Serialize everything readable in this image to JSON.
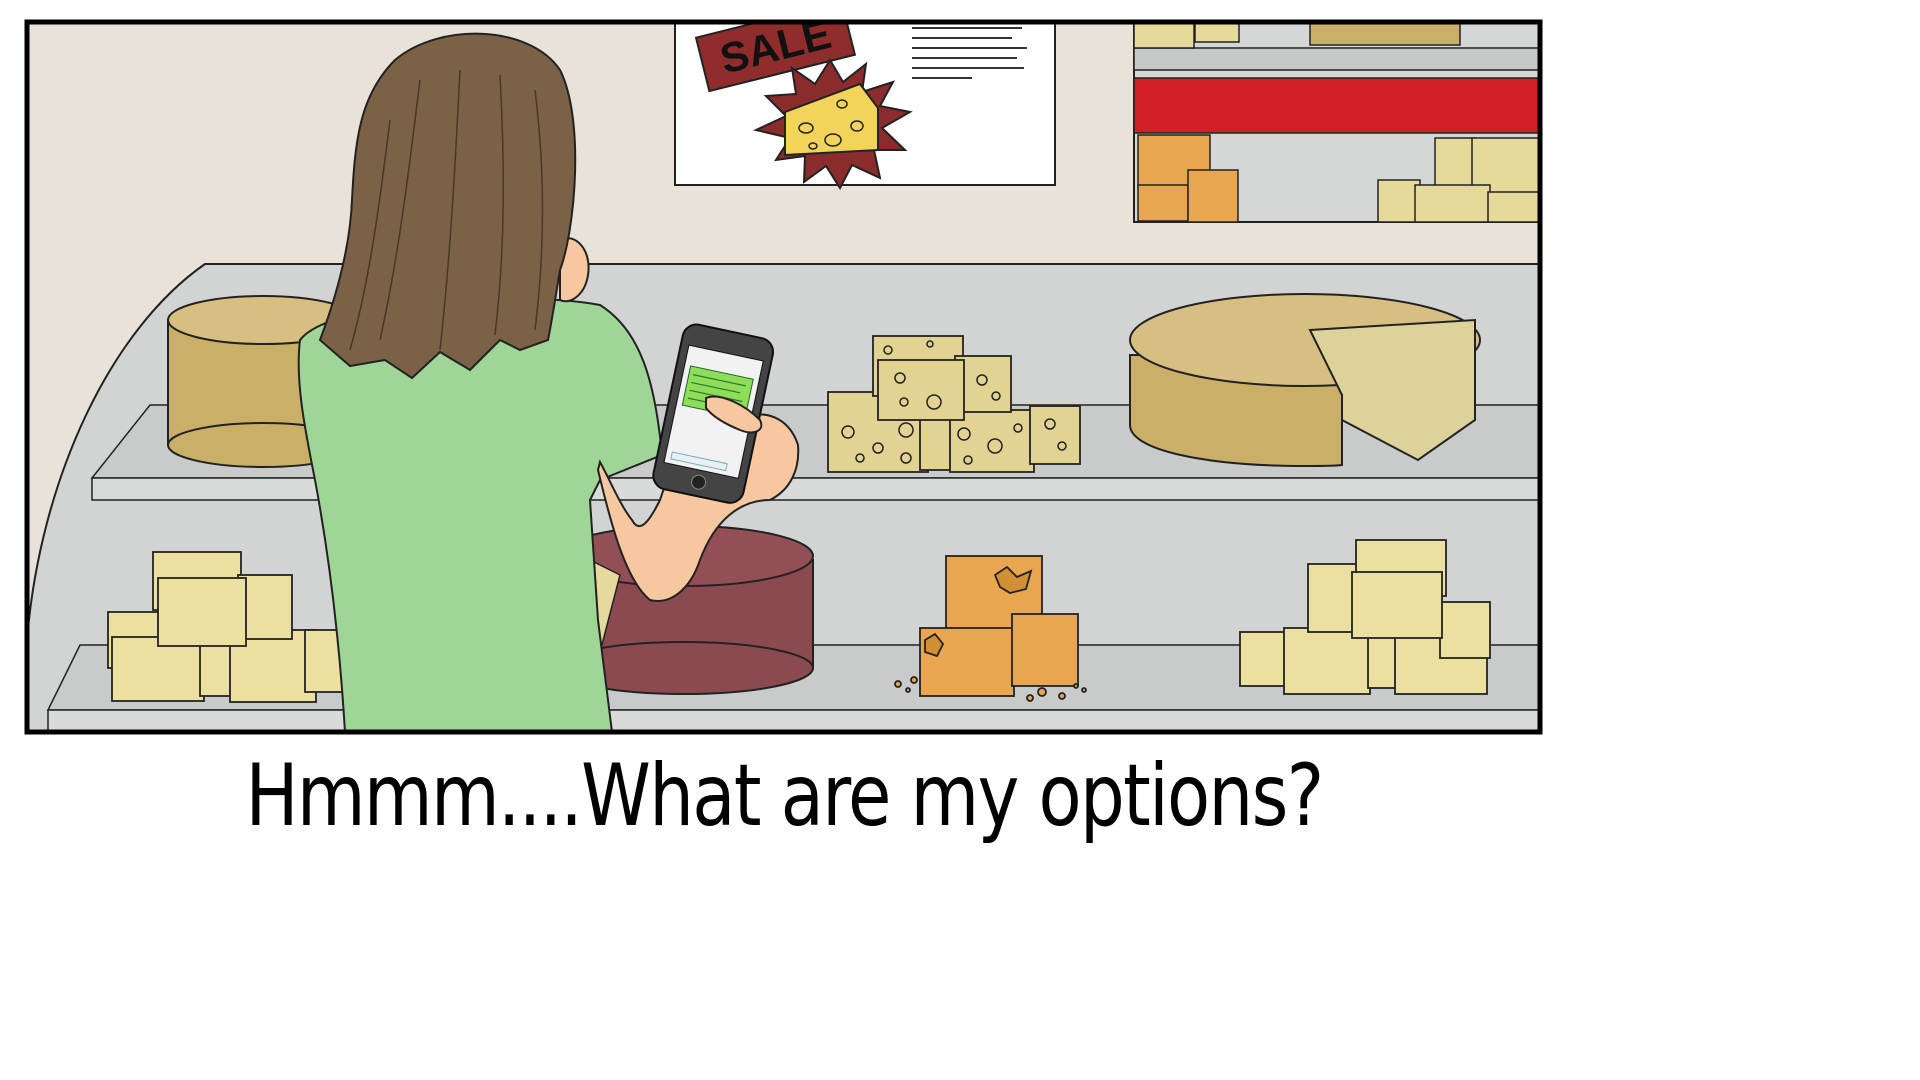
{
  "caption": "Hmmm....What are my options?",
  "sign": {
    "sale_label": "SALE"
  },
  "colors": {
    "wall": "#e8e2d8",
    "shelf": "#d2d4d3",
    "shelf_edge": "#c6c8c7",
    "hair": "#7b6146",
    "shirt": "#9fd597",
    "skin": "#f7c89f",
    "cheese_wheel": "#c9af68",
    "swiss": "#e3d392",
    "block_cheese": "#ebe09f",
    "cheddar": "#e7a64f",
    "red_wheel": "#8a4a50",
    "red_band": "#d41f25",
    "phone_screen_msg": "#8fdc5a"
  },
  "icons": [
    "cheese-burst-icon",
    "phone-icon"
  ]
}
